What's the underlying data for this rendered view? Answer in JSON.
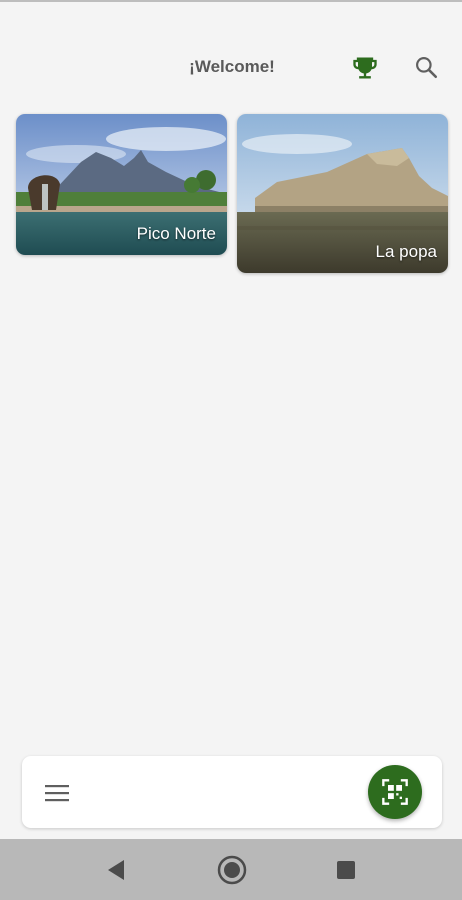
{
  "header": {
    "welcome_text": "¡Welcome!",
    "trophy_icon": "trophy-icon",
    "search_icon": "search-icon"
  },
  "places": [
    {
      "name": "Pico Norte",
      "image": "landscape-photo-lake-mountain"
    },
    {
      "name": "La popa",
      "image": "landscape-photo-mesa-desert"
    }
  ],
  "bottom_bar": {
    "menu_icon": "hamburger-menu-icon",
    "qr_icon": "qr-scan-icon"
  },
  "nav_bar": {
    "back_icon": "back-triangle-icon",
    "home_icon": "home-circle-icon",
    "recents_icon": "recents-square-icon"
  },
  "colors": {
    "accent": "#2d6c1e",
    "background": "#f4f4f4",
    "nav_bar": "#b8b8b8"
  }
}
